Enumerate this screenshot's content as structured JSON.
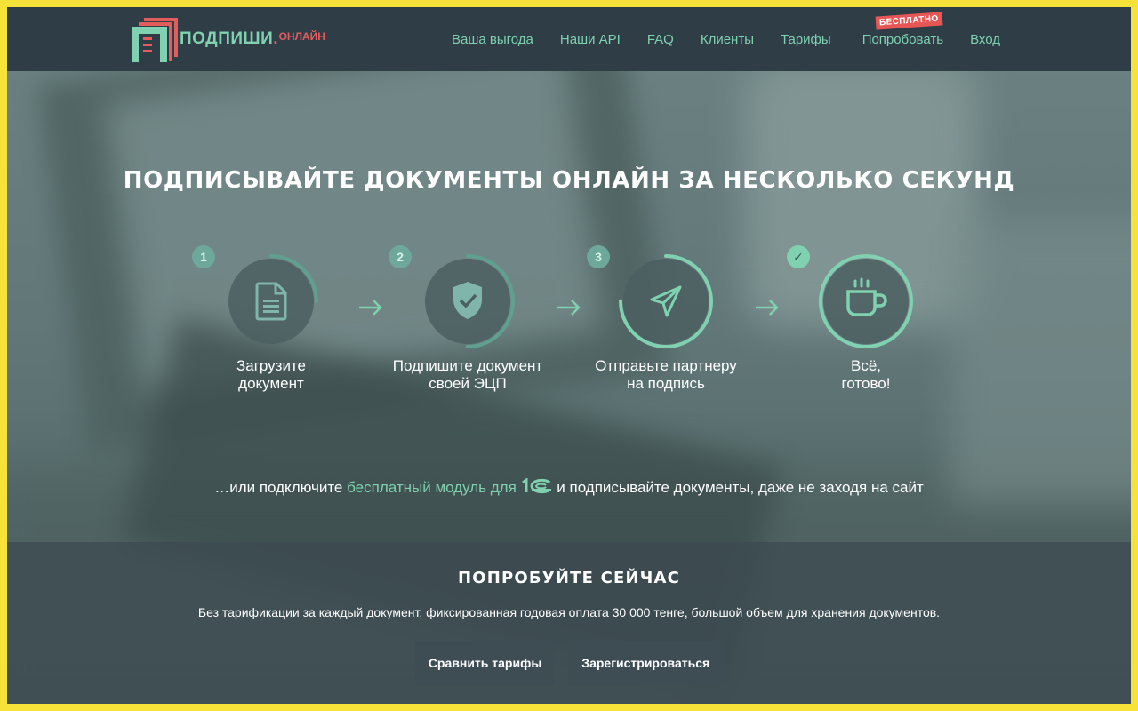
{
  "brand": {
    "name": "ПОДПИШИ",
    "dot": ".",
    "suffix": "ОНЛАЙН",
    "accent_color": "#7fd1b0",
    "red_color": "#e35d5d"
  },
  "nav": {
    "items": [
      {
        "label": "Ваша выгода"
      },
      {
        "label": "Наши API"
      },
      {
        "label": "FAQ"
      },
      {
        "label": "Клиенты"
      },
      {
        "label": "Тарифы"
      },
      {
        "label": "Попробовать",
        "badge": "БЕСПЛАТНО"
      },
      {
        "label": "Вход"
      }
    ]
  },
  "hero": {
    "title": "ПОДПИСЫВАЙТЕ ДОКУМЕНТЫ ОНЛАЙН ЗА НЕСКОЛЬКО СЕКУНД"
  },
  "steps": [
    {
      "number": "1",
      "caption_line1": "Загрузите",
      "caption_line2": "документ",
      "icon": "document-icon",
      "progress": 0.25
    },
    {
      "number": "2",
      "caption_line1": "Подпишите документ",
      "caption_line2": "своей ЭЦП",
      "icon": "shield-check-icon",
      "progress": 0.5
    },
    {
      "number": "3",
      "caption_line1": "Отправьте партнеру",
      "caption_line2": "на подпись",
      "icon": "send-icon",
      "progress": 0.75
    },
    {
      "number": "✓",
      "caption_line1": "Всё,",
      "caption_line2": "готово!",
      "icon": "coffee-cup-icon",
      "progress": 1
    }
  ],
  "module_line": {
    "prefix": "…или подключите ",
    "link": "бесплатный модуль для",
    "suffix": " и подписывайте документы, даже не заходя на сайт",
    "logo_icon": "1c-logo-icon"
  },
  "cta": {
    "title": "ПОПРОБУЙТЕ СЕЙЧАС",
    "text": "Без тарификации за каждый документ, фиксированная годовая оплата 30 000 тенге, большой объем для хранения документов.",
    "compare_label": "Сравнить тарифы",
    "register_label": "Зарегистрироваться"
  }
}
